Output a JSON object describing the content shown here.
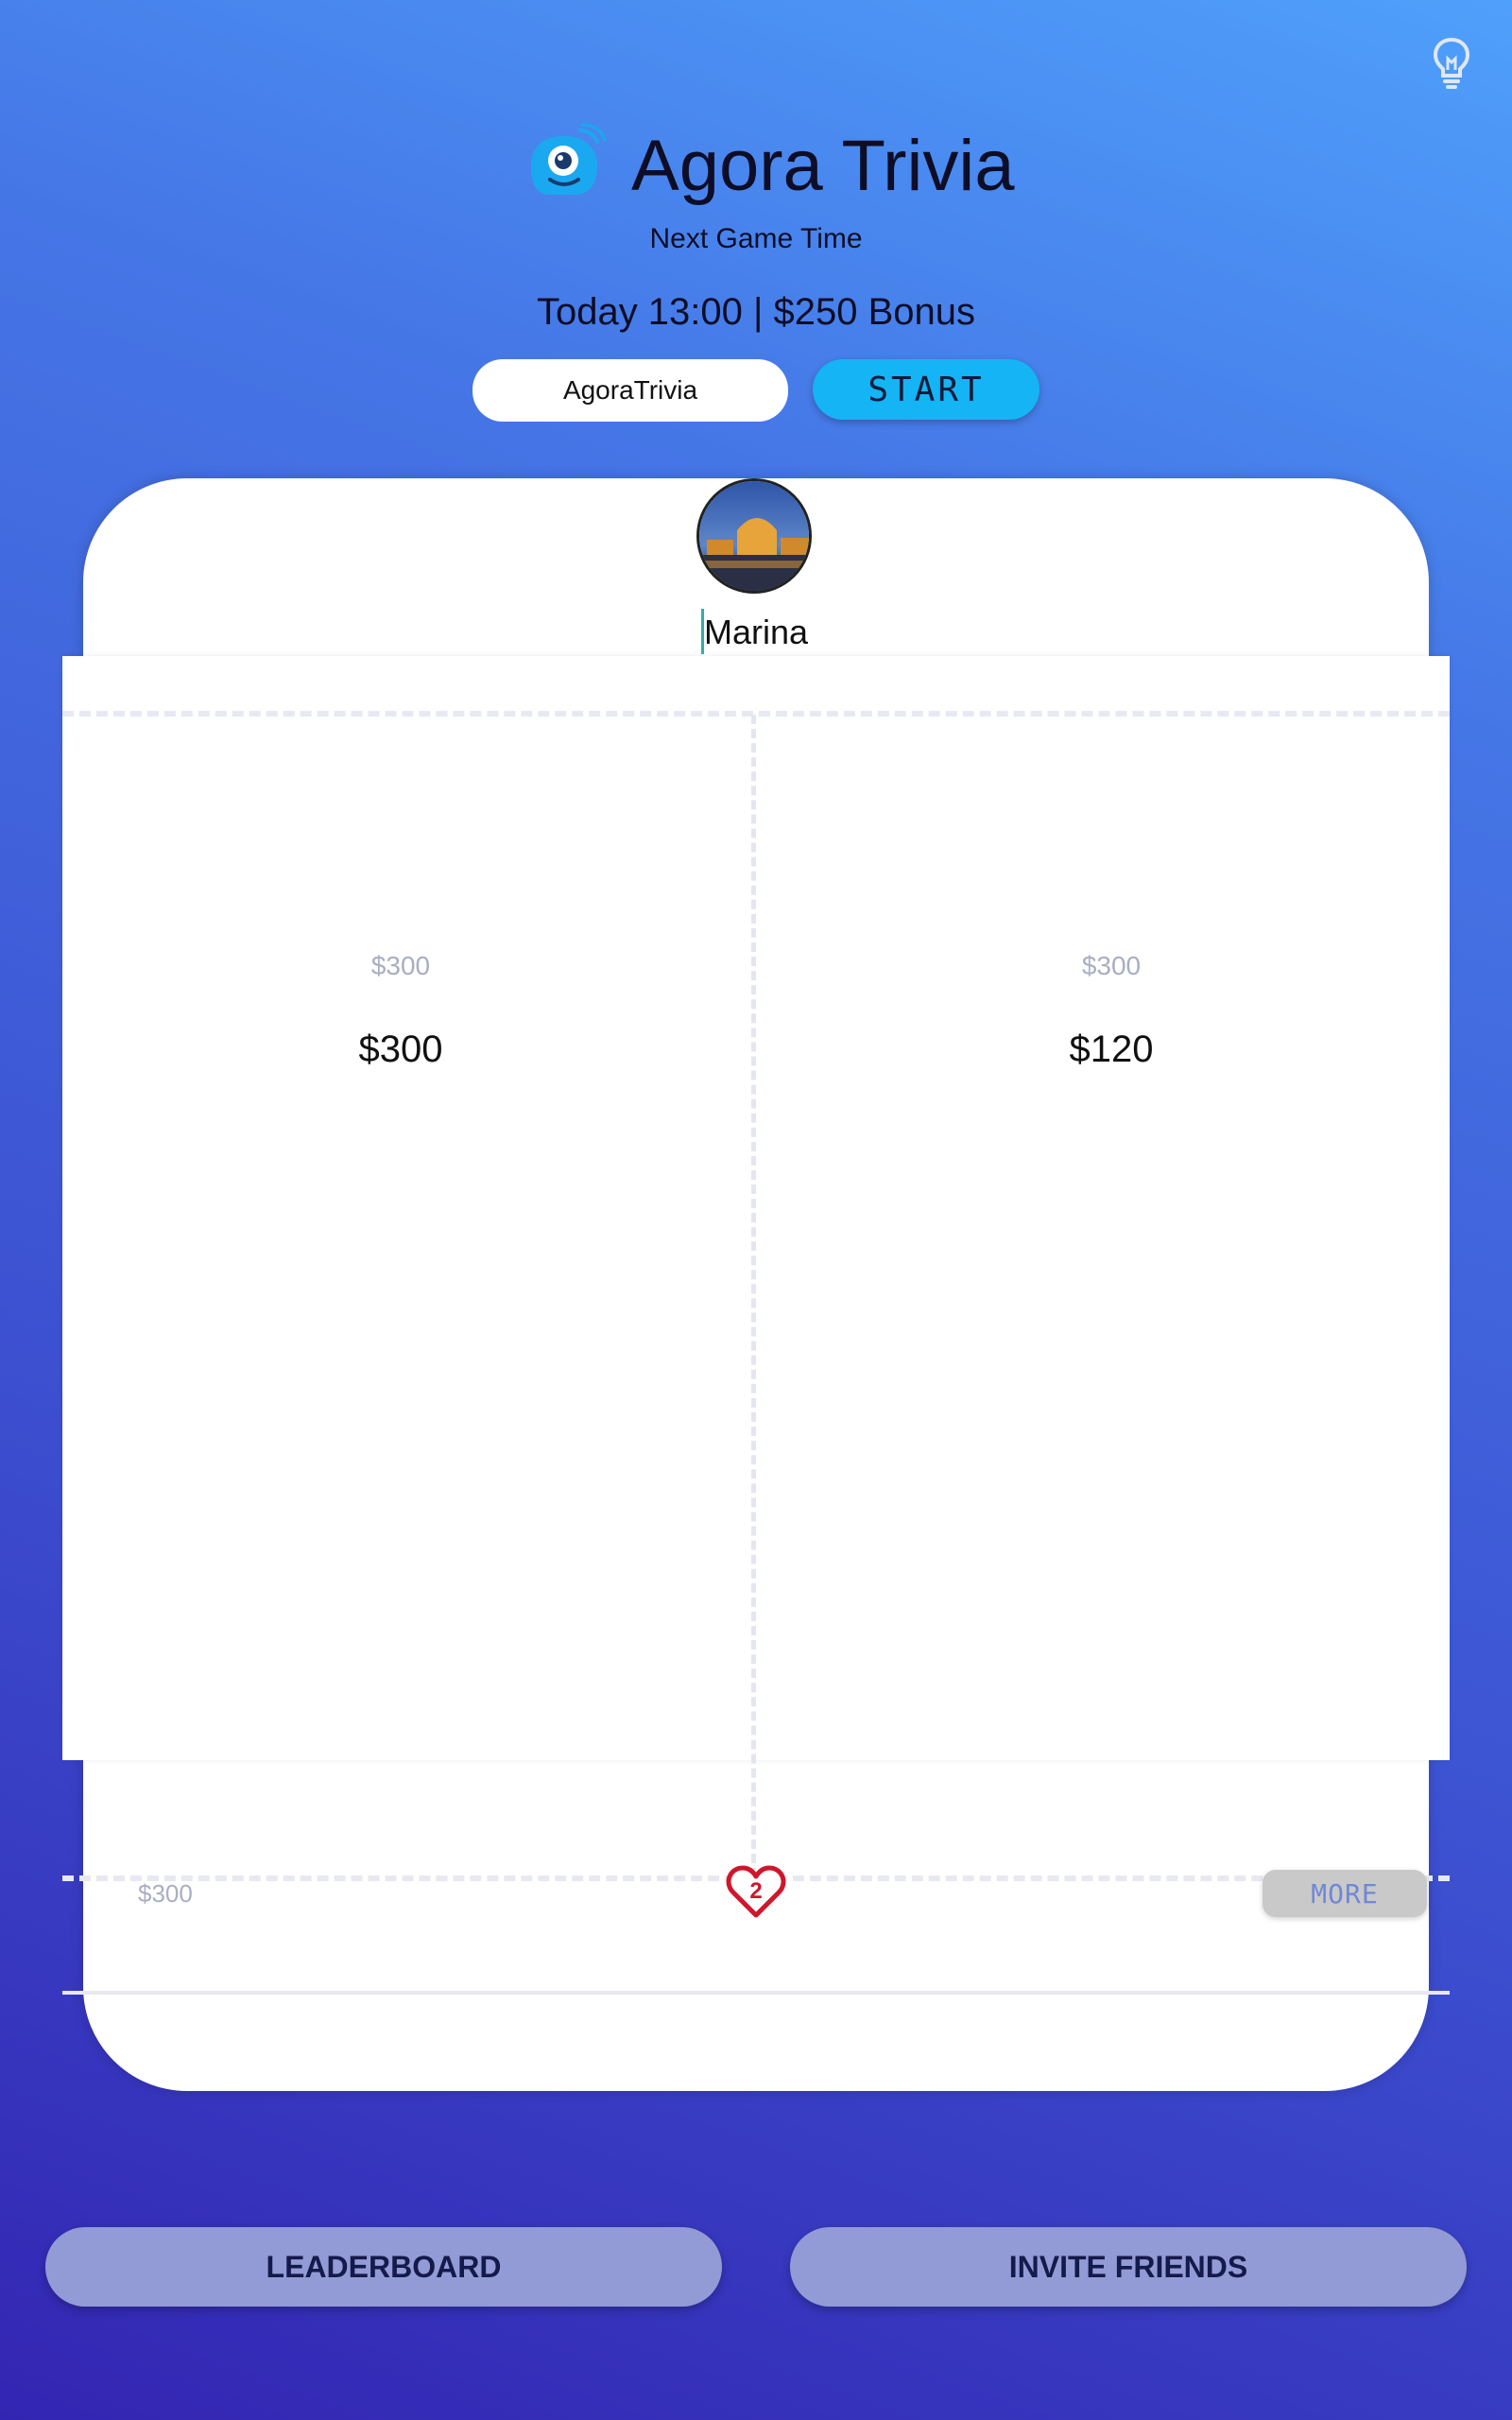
{
  "header": {
    "app_title": "Agora Trivia",
    "next_game_label": "Next Game Time",
    "game_time": "Today 13:00 | $250 Bonus"
  },
  "join": {
    "name_value": "AgoraTrivia",
    "start_label": "START"
  },
  "profile": {
    "username": "Marina"
  },
  "columns": [
    {
      "label": "$300",
      "amount": "$300"
    },
    {
      "label": "$300",
      "amount": "$120"
    }
  ],
  "footer_card": {
    "amount": "$300",
    "lives": "2",
    "more_label": "MORE"
  },
  "actions": {
    "leaderboard_label": "LEADERBOARD",
    "invite_label": "INVITE FRIENDS"
  },
  "colors": {
    "accent": "#14b4f5",
    "heart": "#d0162c",
    "bg_top": "#4fa0fb",
    "bg_bottom": "#3325b3"
  },
  "icons": [
    "lightbulb-icon",
    "agora-logo-icon",
    "heart-icon"
  ]
}
